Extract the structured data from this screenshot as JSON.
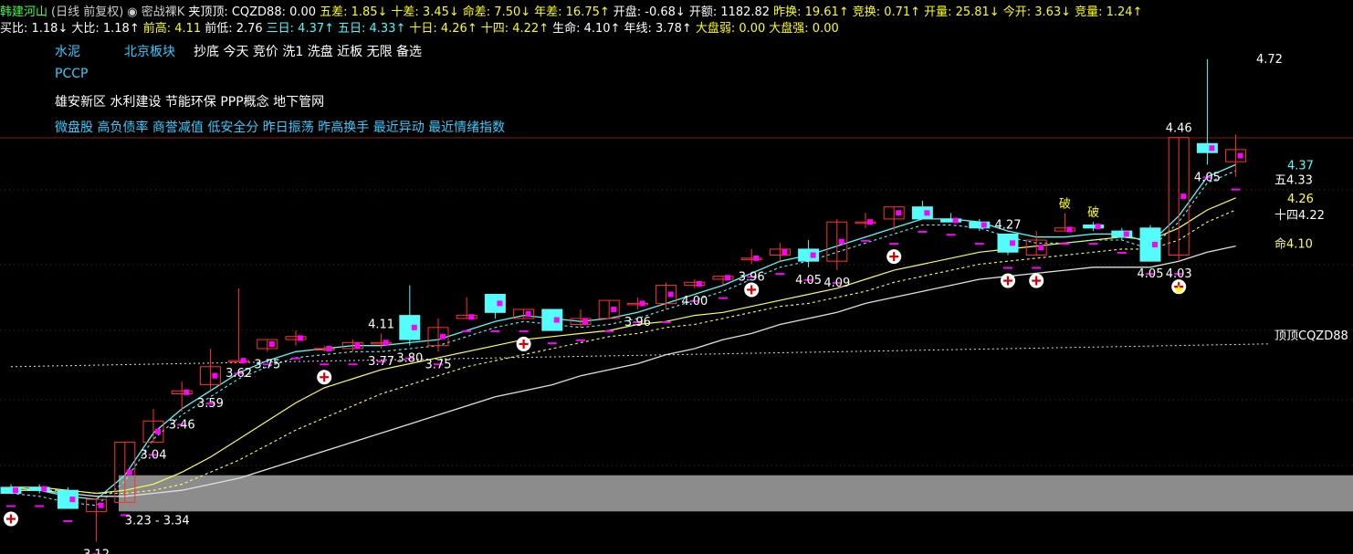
{
  "header": {
    "line1": [
      {
        "text": "韩建河山",
        "color": "#44ff44"
      },
      {
        "text": "(日线 前复权)",
        "color": "#cccccc"
      },
      {
        "text": "◉ 密战裸K",
        "color": "#cccccc"
      },
      {
        "text": "夹顶顶: CQZD88: 0.00",
        "color": "#ffffff"
      },
      {
        "text": "五差: 1.85↓",
        "color": "#ffff00"
      },
      {
        "text": "十差: 3.45↓",
        "color": "#ffff00"
      },
      {
        "text": "命差: 7.50↓",
        "color": "#ffff00"
      },
      {
        "text": "年差: 16.75↑",
        "color": "#ffff00"
      },
      {
        "text": "开盘: -0.68↓",
        "color": "#ffffff"
      },
      {
        "text": "开额: 1182.82",
        "color": "#ffffff"
      },
      {
        "text": "昨换: 19.61↑",
        "color": "#ffff00"
      },
      {
        "text": "竞换: 0.71↑",
        "color": "#ffff00"
      },
      {
        "text": "开量: 25.81↓",
        "color": "#ffff00"
      },
      {
        "text": "今开: 3.63↓",
        "color": "#ffff00"
      },
      {
        "text": "竞量: 1.24↑",
        "color": "#ffff00"
      }
    ],
    "line2": [
      {
        "text": "买比: 1.18↓",
        "color": "#ffffff"
      },
      {
        "text": "大比: 1.18↑",
        "color": "#ffffff"
      },
      {
        "text": "前高: 4.11",
        "color": "#ffff00"
      },
      {
        "text": "前低: 2.76",
        "color": "#ffffff"
      },
      {
        "text": "三日: 4.37↑",
        "color": "#44ffff"
      },
      {
        "text": "五日: 4.33↑",
        "color": "#44ffff"
      },
      {
        "text": "十日: 4.26↑",
        "color": "#ffff00"
      },
      {
        "text": "十四: 4.22↑",
        "color": "#ffff00"
      },
      {
        "text": "生命: 4.10↑",
        "color": "#ffffff"
      },
      {
        "text": "年线: 3.78↑",
        "color": "#ffffff"
      },
      {
        "text": "大盘弱: 0.00",
        "color": "#ffff00"
      },
      {
        "text": "大盘强: 0.00",
        "color": "#ffff00"
      }
    ]
  },
  "tags": [
    {
      "text": "水泥",
      "color": "#33ccff"
    },
    {
      "text": "北京板块",
      "color": "#33ccff"
    },
    {
      "text": "抄底 今天 竞价 洗1 洗盘 近板 无限 备选",
      "color": "#ffffff"
    },
    {
      "text": "PCCP",
      "color": "#33ccff"
    },
    {
      "text": "雄安新区 水利建设 节能环保 PPP概念 地下管网",
      "color": "#ffffff"
    },
    {
      "text": "微盘股 高负债率 商誉减值 低安全分 昨日振荡 昨高换手 最近异动 最近情绪指数",
      "color": "#33ccff"
    }
  ],
  "right_labels": {
    "top": "4.72",
    "ma3": "4.37",
    "ma5": "五4.33",
    "ma10": "4.26",
    "ma14": "十四4.22",
    "life": "命4.10",
    "cqzd": "顶顶CQZD88"
  },
  "colors": {
    "up": "#ff3232",
    "down": "#54fcfc",
    "ma3": "#54fcfc",
    "ma10": "#ffff54",
    "life": "#e0e0e0",
    "marker": "#ff00ff",
    "band": "#8c8c8c"
  },
  "chart_data": {
    "type": "candlestick",
    "y_axis": {
      "min": 3.1,
      "max": 4.78
    },
    "candles": [
      {
        "o": 3.3,
        "h": 3.31,
        "l": 3.28,
        "c": 3.28
      },
      {
        "o": 3.3,
        "h": 3.31,
        "l": 3.28,
        "c": 3.29
      },
      {
        "o": 3.29,
        "h": 3.3,
        "l": 3.23,
        "c": 3.23
      },
      {
        "o": 3.22,
        "h": 3.26,
        "l": 3.12,
        "c": 3.26
      },
      {
        "o": 3.25,
        "h": 3.45,
        "l": 3.25,
        "c": 3.45
      },
      {
        "o": 3.45,
        "h": 3.56,
        "l": 3.45,
        "c": 3.52
      },
      {
        "o": 3.61,
        "h": 3.65,
        "l": 3.55,
        "c": 3.62
      },
      {
        "o": 3.64,
        "h": 3.76,
        "l": 3.62,
        "c": 3.7
      },
      {
        "o": 3.72,
        "h": 3.96,
        "l": 3.72,
        "c": 3.72
      },
      {
        "o": 3.76,
        "h": 3.79,
        "l": 3.75,
        "c": 3.79
      },
      {
        "o": 3.79,
        "h": 3.82,
        "l": 3.77,
        "c": 3.8
      },
      {
        "o": 3.76,
        "h": 3.77,
        "l": 3.75,
        "c": 3.76
      },
      {
        "o": 3.76,
        "h": 3.79,
        "l": 3.75,
        "c": 3.78
      },
      {
        "o": 3.78,
        "h": 3.81,
        "l": 3.76,
        "c": 3.78
      },
      {
        "o": 3.87,
        "h": 3.97,
        "l": 3.77,
        "c": 3.79
      },
      {
        "o": 3.77,
        "h": 3.86,
        "l": 3.75,
        "c": 3.83
      },
      {
        "o": 3.86,
        "h": 3.93,
        "l": 3.86,
        "c": 3.87
      },
      {
        "o": 3.94,
        "h": 3.94,
        "l": 3.86,
        "c": 3.88
      },
      {
        "o": 3.86,
        "h": 3.89,
        "l": 3.86,
        "c": 3.89
      },
      {
        "o": 3.89,
        "h": 3.89,
        "l": 3.82,
        "c": 3.82
      },
      {
        "o": 3.84,
        "h": 3.89,
        "l": 3.83,
        "c": 3.86
      },
      {
        "o": 3.86,
        "h": 3.92,
        "l": 3.86,
        "c": 3.92
      },
      {
        "o": 3.91,
        "h": 3.93,
        "l": 3.89,
        "c": 3.91
      },
      {
        "o": 3.91,
        "h": 3.98,
        "l": 3.89,
        "c": 3.97
      },
      {
        "o": 3.97,
        "h": 3.99,
        "l": 3.96,
        "c": 3.98
      },
      {
        "o": 3.99,
        "h": 4.0,
        "l": 3.97,
        "c": 4.0
      },
      {
        "o": 4.06,
        "h": 4.09,
        "l": 4.04,
        "c": 4.06
      },
      {
        "o": 4.07,
        "h": 4.11,
        "l": 4.05,
        "c": 4.09
      },
      {
        "o": 4.09,
        "h": 4.12,
        "l": 4.03,
        "c": 4.05
      },
      {
        "o": 4.05,
        "h": 4.19,
        "l": 4.02,
        "c": 4.18
      },
      {
        "o": 4.18,
        "h": 4.21,
        "l": 4.16,
        "c": 4.18
      },
      {
        "o": 4.19,
        "h": 4.23,
        "l": 4.15,
        "c": 4.23
      },
      {
        "o": 4.23,
        "h": 4.25,
        "l": 4.19,
        "c": 4.19
      },
      {
        "o": 4.19,
        "h": 4.21,
        "l": 4.18,
        "c": 4.18
      },
      {
        "o": 4.18,
        "h": 4.19,
        "l": 4.15,
        "c": 4.16
      },
      {
        "o": 4.14,
        "h": 4.14,
        "l": 4.07,
        "c": 4.08
      },
      {
        "o": 4.07,
        "h": 4.15,
        "l": 4.07,
        "c": 4.12
      },
      {
        "o": 4.15,
        "h": 4.21,
        "l": 4.15,
        "c": 4.16
      },
      {
        "o": 4.17,
        "h": 4.18,
        "l": 4.15,
        "c": 4.16
      },
      {
        "o": 4.15,
        "h": 4.16,
        "l": 4.12,
        "c": 4.13
      },
      {
        "o": 4.16,
        "h": 4.17,
        "l": 4.05,
        "c": 4.05
      },
      {
        "o": 4.07,
        "h": 4.46,
        "l": 4.05,
        "c": 4.46
      },
      {
        "o": 4.44,
        "h": 4.72,
        "l": 4.37,
        "c": 4.41
      },
      {
        "o": 4.38,
        "h": 4.47,
        "l": 4.33,
        "c": 4.42
      }
    ],
    "ma3": [
      3.3,
      3.29,
      3.27,
      3.26,
      3.34,
      3.48,
      3.56,
      3.62,
      3.68,
      3.72,
      3.75,
      3.76,
      3.77,
      3.77,
      3.78,
      3.79,
      3.82,
      3.85,
      3.87,
      3.86,
      3.85,
      3.86,
      3.88,
      3.91,
      3.94,
      3.97,
      4.01,
      4.05,
      4.07,
      4.1,
      4.13,
      4.16,
      4.19,
      4.19,
      4.18,
      4.15,
      4.13,
      4.13,
      4.14,
      4.14,
      4.11,
      4.2,
      4.33,
      4.37
    ],
    "ma10": [
      3.3,
      3.3,
      3.29,
      3.28,
      3.29,
      3.31,
      3.35,
      3.4,
      3.46,
      3.52,
      3.58,
      3.63,
      3.66,
      3.69,
      3.71,
      3.73,
      3.75,
      3.77,
      3.79,
      3.8,
      3.81,
      3.82,
      3.84,
      3.85,
      3.87,
      3.88,
      3.9,
      3.92,
      3.94,
      3.96,
      3.99,
      4.02,
      4.04,
      4.06,
      4.08,
      4.09,
      4.1,
      4.11,
      4.12,
      4.13,
      4.12,
      4.16,
      4.22,
      4.26
    ],
    "ma14": [
      3.29,
      3.29,
      3.29,
      3.28,
      3.28,
      3.29,
      3.31,
      3.35,
      3.39,
      3.44,
      3.49,
      3.53,
      3.57,
      3.61,
      3.64,
      3.67,
      3.7,
      3.72,
      3.74,
      3.76,
      3.78,
      3.8,
      3.81,
      3.83,
      3.84,
      3.86,
      3.88,
      3.9,
      3.91,
      3.93,
      3.95,
      3.98,
      4.0,
      4.02,
      4.04,
      4.05,
      4.06,
      4.07,
      4.08,
      4.09,
      4.09,
      4.12,
      4.18,
      4.22
    ],
    "life": [
      3.29,
      3.29,
      3.28,
      3.27,
      3.27,
      3.28,
      3.29,
      3.31,
      3.33,
      3.36,
      3.39,
      3.42,
      3.45,
      3.48,
      3.51,
      3.54,
      3.57,
      3.6,
      3.62,
      3.64,
      3.67,
      3.69,
      3.71,
      3.74,
      3.76,
      3.79,
      3.81,
      3.84,
      3.86,
      3.88,
      3.91,
      3.93,
      3.95,
      3.97,
      3.99,
      4.0,
      4.01,
      4.02,
      4.03,
      4.03,
      4.03,
      4.05,
      4.08,
      4.1
    ],
    "cqzd_line": 3.7,
    "gray_band": [
      3.22,
      3.34
    ],
    "price_labels": [
      {
        "i": 3,
        "v": "3.12",
        "pos": "below"
      },
      {
        "i": 4,
        "v": "3.23 - 3.34",
        "pos": "belowleft"
      },
      {
        "i": 5,
        "v": "3.04",
        "pos": "below"
      },
      {
        "i": 6,
        "v": "3.46",
        "pos": "below"
      },
      {
        "i": 7,
        "v": "3.59",
        "pos": "below"
      },
      {
        "i": 8,
        "v": "3.62",
        "pos": "below"
      },
      {
        "i": 9,
        "v": "3.75",
        "pos": "below"
      },
      {
        "i": 13,
        "v": "4.11",
        "pos": "above"
      },
      {
        "i": 13,
        "v": "3.77",
        "pos": "below"
      },
      {
        "i": 14,
        "v": "3.80",
        "pos": "below"
      },
      {
        "i": 15,
        "v": "3.75",
        "pos": "below"
      },
      {
        "i": 22,
        "v": "3.96",
        "pos": "below"
      },
      {
        "i": 24,
        "v": "4.00",
        "pos": "below"
      },
      {
        "i": 26,
        "v": "3.96",
        "pos": "below"
      },
      {
        "i": 28,
        "v": "4.05",
        "pos": "below"
      },
      {
        "i": 29,
        "v": "4.09",
        "pos": "below"
      },
      {
        "i": 35,
        "v": "4.27",
        "pos": "above"
      },
      {
        "i": 37,
        "v": "破",
        "pos": "above"
      },
      {
        "i": 38,
        "v": "破",
        "pos": "above"
      },
      {
        "i": 40,
        "v": "4.05",
        "pos": "below"
      },
      {
        "i": 41,
        "v": "4.46",
        "pos": "above"
      },
      {
        "i": 41,
        "v": "4.03",
        "pos": "below"
      },
      {
        "i": 42,
        "v": "4.05",
        "pos": "below"
      }
    ],
    "plus_markers": [
      0,
      11,
      18,
      26,
      31,
      35,
      36,
      41
    ],
    "star_markers": [
      41
    ]
  }
}
